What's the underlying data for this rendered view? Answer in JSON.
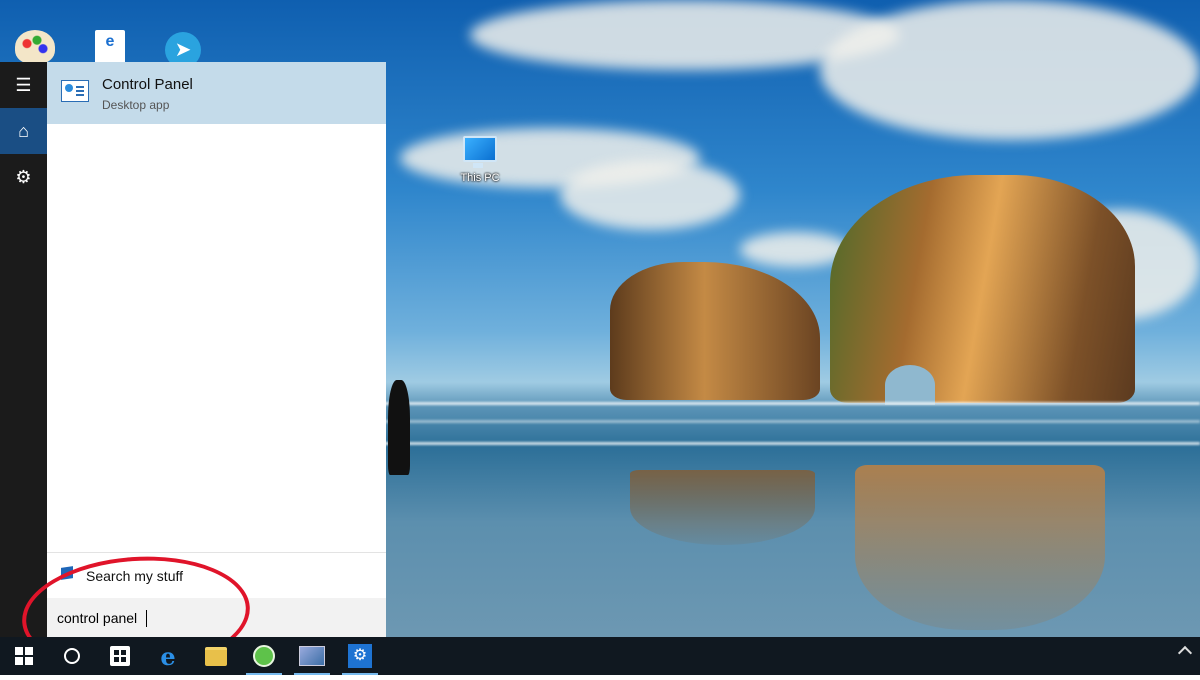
{
  "desktop": {
    "icons": [
      {
        "name": "This PC"
      }
    ]
  },
  "start_menu": {
    "rail": {
      "hamburger_icon": "hamburger-icon",
      "home_icon": "home-icon",
      "settings_icon": "gear-icon"
    },
    "results": [
      {
        "title": "Control Panel",
        "subtitle": "Desktop app",
        "icon": "control-panel-icon"
      }
    ],
    "my_stuff_label": "Search my stuff",
    "search_query": "control panel"
  },
  "taskbar": {
    "items": [
      "start-button",
      "cortana-button",
      "store-button",
      "edge-button",
      "file-explorer-button",
      "green-app-button",
      "control-panel-app-button",
      "settings-app-button"
    ]
  },
  "colors": {
    "accent": "#1a4e84",
    "result_highlight": "#c4dbea",
    "annotation": "#e0142a"
  }
}
